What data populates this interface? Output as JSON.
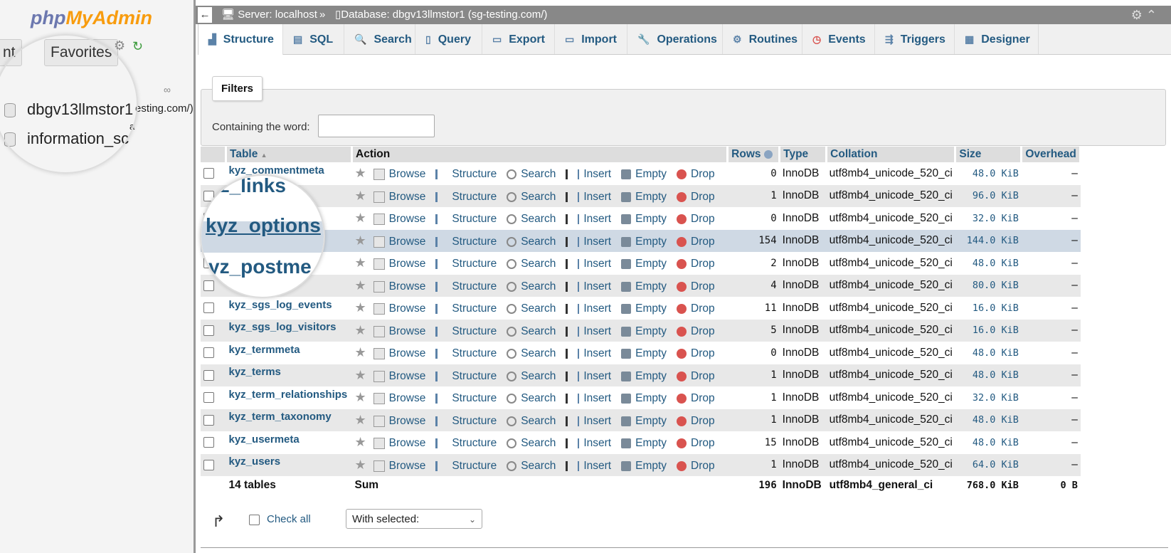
{
  "sidebar": {
    "logo_part1": "php",
    "logo_part2": "MyAdmin",
    "tab_recent": "nt",
    "tab_favorites": "Favorites",
    "db_selected": "dbgv13llmstor1",
    "db_info": "information_sc",
    "db_info_suffix": "a",
    "db_url_tail": "esting.com/)"
  },
  "topbar": {
    "back": "←",
    "server": "Server: localhost",
    "sep": "»",
    "database": "Database: dbgv13llmstor1 (sg-testing.com/)"
  },
  "tabs": [
    "Structure",
    "SQL",
    "Search",
    "Query",
    "Export",
    "Import",
    "Operations",
    "Routines",
    "Events",
    "Triggers",
    "Designer"
  ],
  "filters": {
    "legend": "Filters",
    "label": "Containing the word:",
    "value": ""
  },
  "table": {
    "headers": {
      "table": "Table",
      "sort": "▲",
      "action": "Action",
      "rows": "Rows",
      "type": "Type",
      "collation": "Collation",
      "size": "Size",
      "overhead": "Overhead"
    },
    "actions": {
      "browse": "Browse",
      "structure": "Structure",
      "search": "Search",
      "insert": "Insert",
      "empty": "Empty",
      "drop": "Drop"
    },
    "rows": [
      {
        "name": "kyz_commentmeta",
        "rows": "0",
        "type": "InnoDB",
        "collation": "utf8mb4_unicode_520_ci",
        "size": "48.0 KiB",
        "overhead": "–"
      },
      {
        "name": "kyz_links",
        "rows": "1",
        "type": "InnoDB",
        "collation": "utf8mb4_unicode_520_ci",
        "size": "96.0 KiB",
        "overhead": "–"
      },
      {
        "name": "",
        "rows": "0",
        "type": "InnoDB",
        "collation": "utf8mb4_unicode_520_ci",
        "size": "32.0 KiB",
        "overhead": "–"
      },
      {
        "name": "",
        "rows": "154",
        "type": "InnoDB",
        "collation": "utf8mb4_unicode_520_ci",
        "size": "144.0 KiB",
        "overhead": "–"
      },
      {
        "name": "",
        "rows": "2",
        "type": "InnoDB",
        "collation": "utf8mb4_unicode_520_ci",
        "size": "48.0 KiB",
        "overhead": "–"
      },
      {
        "name": "",
        "rows": "4",
        "type": "InnoDB",
        "collation": "utf8mb4_unicode_520_ci",
        "size": "80.0 KiB",
        "overhead": "–"
      },
      {
        "name": "kyz_sgs_log_events",
        "rows": "11",
        "type": "InnoDB",
        "collation": "utf8mb4_unicode_520_ci",
        "size": "16.0 KiB",
        "overhead": "–"
      },
      {
        "name": "kyz_sgs_log_visitors",
        "rows": "5",
        "type": "InnoDB",
        "collation": "utf8mb4_unicode_520_ci",
        "size": "16.0 KiB",
        "overhead": "–"
      },
      {
        "name": "kyz_termmeta",
        "rows": "0",
        "type": "InnoDB",
        "collation": "utf8mb4_unicode_520_ci",
        "size": "48.0 KiB",
        "overhead": "–"
      },
      {
        "name": "kyz_terms",
        "rows": "1",
        "type": "InnoDB",
        "collation": "utf8mb4_unicode_520_ci",
        "size": "48.0 KiB",
        "overhead": "–"
      },
      {
        "name": "kyz_term_relationships",
        "rows": "1",
        "type": "InnoDB",
        "collation": "utf8mb4_unicode_520_ci",
        "size": "32.0 KiB",
        "overhead": "–"
      },
      {
        "name": "kyz_term_taxonomy",
        "rows": "1",
        "type": "InnoDB",
        "collation": "utf8mb4_unicode_520_ci",
        "size": "48.0 KiB",
        "overhead": "–"
      },
      {
        "name": "kyz_usermeta",
        "rows": "15",
        "type": "InnoDB",
        "collation": "utf8mb4_unicode_520_ci",
        "size": "48.0 KiB",
        "overhead": "–"
      },
      {
        "name": "kyz_users",
        "rows": "1",
        "type": "InnoDB",
        "collation": "utf8mb4_unicode_520_ci",
        "size": "64.0 KiB",
        "overhead": "–"
      }
    ],
    "footer": {
      "count": "14 tables",
      "sum": "Sum",
      "rows": "196",
      "type": "InnoDB",
      "collation": "utf8mb4_general_ci",
      "size": "768.0 KiB",
      "overhead": "0 B"
    }
  },
  "magnifier": {
    "line1": "yz_links",
    "line2": "kyz_options",
    "line3": "yz_postme"
  },
  "bottom": {
    "check_all": "Check all",
    "with_selected": "With selected:"
  }
}
